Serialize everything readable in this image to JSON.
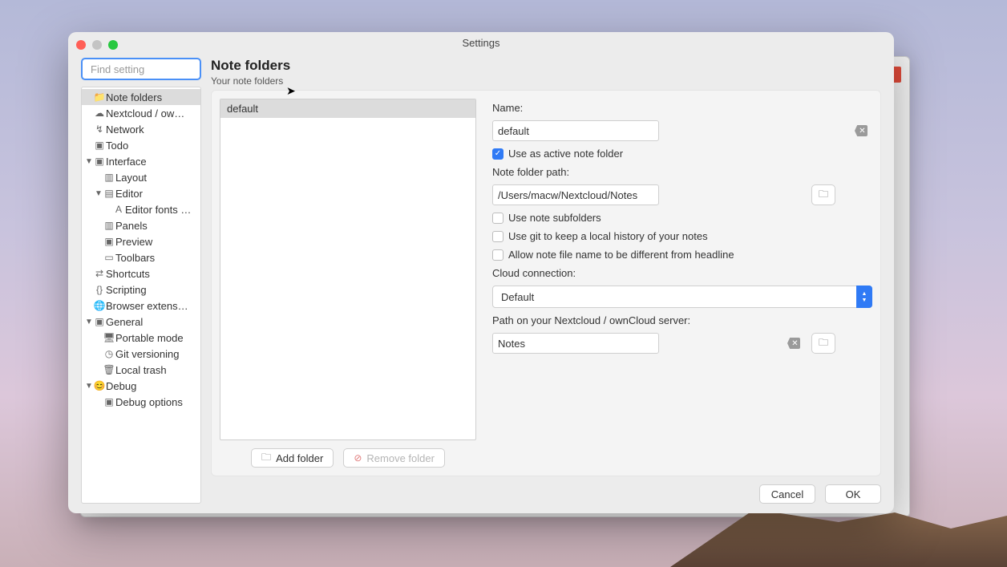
{
  "window": {
    "title": "Settings"
  },
  "search": {
    "placeholder": "Find setting"
  },
  "sidebar": {
    "items": [
      {
        "label": "Note folders",
        "icon": "📁",
        "indent": 0,
        "selected": true
      },
      {
        "label": "Nextcloud / ow…",
        "icon": "☁",
        "indent": 0
      },
      {
        "label": "Network",
        "icon": "↯",
        "indent": 0
      },
      {
        "label": "Todo",
        "icon": "▣",
        "indent": 0
      },
      {
        "label": "Interface",
        "icon": "▣",
        "indent": 0,
        "arrow": "▼"
      },
      {
        "label": "Layout",
        "icon": "▥",
        "indent": 1
      },
      {
        "label": "Editor",
        "icon": "▤",
        "indent": 1,
        "arrow": "▼"
      },
      {
        "label": "Editor fonts …",
        "icon": "A",
        "indent": 2
      },
      {
        "label": "Panels",
        "icon": "▥",
        "indent": 1
      },
      {
        "label": "Preview",
        "icon": "▣",
        "indent": 1
      },
      {
        "label": "Toolbars",
        "icon": "▭",
        "indent": 1
      },
      {
        "label": "Shortcuts",
        "icon": "⇄",
        "indent": 0
      },
      {
        "label": "Scripting",
        "icon": "{}",
        "indent": 0
      },
      {
        "label": "Browser extens…",
        "icon": "🌐",
        "indent": 0
      },
      {
        "label": "General",
        "icon": "▣",
        "indent": 0,
        "arrow": "▼"
      },
      {
        "label": "Portable mode",
        "icon": "🖥",
        "indent": 1
      },
      {
        "label": "Git versioning",
        "icon": "◷",
        "indent": 1
      },
      {
        "label": "Local trash",
        "icon": "🗑",
        "indent": 1
      },
      {
        "label": "Debug",
        "icon": "😊",
        "indent": 0,
        "arrow": "▼"
      },
      {
        "label": "Debug options",
        "icon": "▣",
        "indent": 1
      }
    ]
  },
  "page": {
    "title": "Note folders",
    "section_label": "Your note folders"
  },
  "folders": {
    "items": [
      {
        "name": "default"
      }
    ],
    "add_label": "Add folder",
    "remove_label": "Remove folder"
  },
  "form": {
    "name_label": "Name:",
    "name_value": "default",
    "use_active_label": "Use as active note folder",
    "use_active_checked": true,
    "path_label": "Note folder path:",
    "path_value": "/Users/macw/Nextcloud/Notes",
    "use_subfolders_label": "Use note subfolders",
    "use_git_label": "Use git to keep a local history of your notes",
    "allow_filename_label": "Allow note file name to be different from headline",
    "cloud_label": "Cloud connection:",
    "cloud_value": "Default",
    "server_path_label": "Path on your Nextcloud / ownCloud server:",
    "server_path_value": "Notes"
  },
  "footer": {
    "cancel": "Cancel",
    "ok": "OK"
  }
}
